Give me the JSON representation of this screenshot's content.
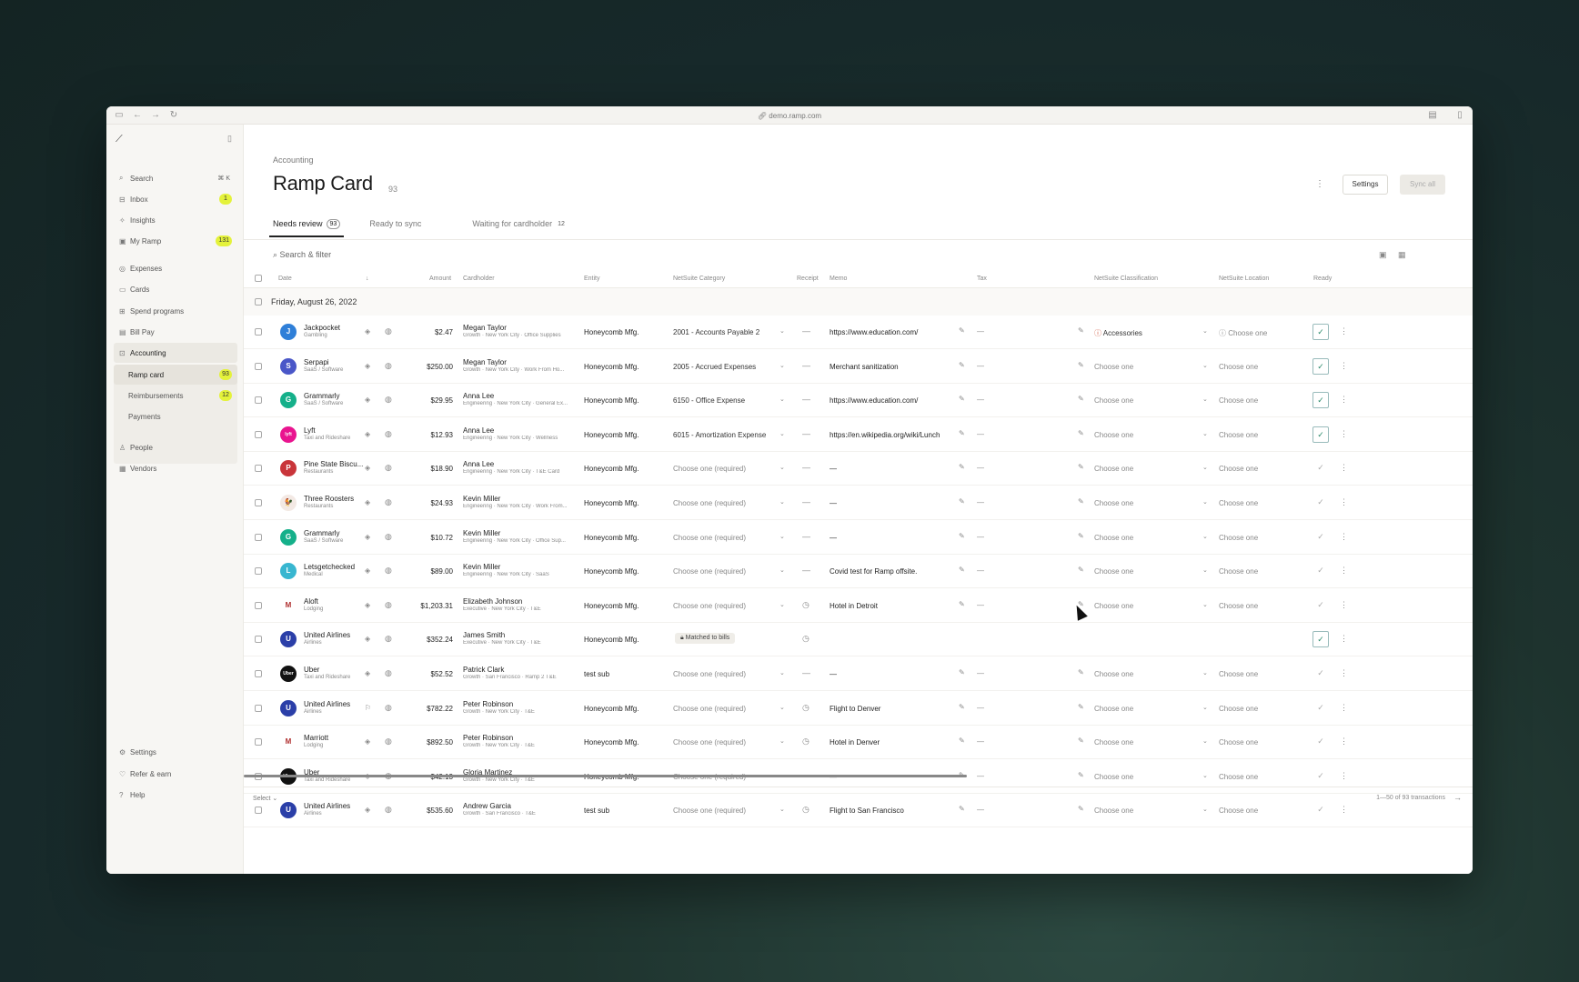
{
  "browser": {
    "url": "demo.ramp.com"
  },
  "sidebar": {
    "search": {
      "label": "Search",
      "shortcut": "⌘ K"
    },
    "items": [
      {
        "label": "Inbox",
        "badge": "1"
      },
      {
        "label": "Insights",
        "badge": ""
      },
      {
        "label": "My Ramp",
        "badge": "131"
      },
      {
        "label": "Expenses",
        "badge": ""
      },
      {
        "label": "Cards",
        "badge": ""
      },
      {
        "label": "Spend programs",
        "badge": ""
      },
      {
        "label": "Bill Pay",
        "badge": ""
      },
      {
        "label": "Accounting",
        "badge": ""
      }
    ],
    "sub_items": [
      {
        "label": "Ramp card",
        "badge": "93"
      },
      {
        "label": "Reimbursements",
        "badge": "12"
      },
      {
        "label": "Payments",
        "badge": ""
      }
    ],
    "bottom_items": [
      {
        "label": "People"
      },
      {
        "label": "Vendors"
      }
    ],
    "footer_items": [
      {
        "label": "Settings"
      },
      {
        "label": "Refer & earn"
      },
      {
        "label": "Help"
      }
    ]
  },
  "header": {
    "breadcrumb": "Accounting",
    "title": "Ramp Card",
    "count": "93",
    "settings_label": "Settings",
    "sync_label": "Sync all"
  },
  "tabs": [
    {
      "label": "Needs review",
      "count": "93"
    },
    {
      "label": "Ready to sync",
      "count": ""
    },
    {
      "label": "Waiting for cardholder",
      "count": "12"
    }
  ],
  "search_placeholder": "Search & filter",
  "columns": {
    "date": "Date",
    "amount": "Amount",
    "cardholder": "Cardholder",
    "entity": "Entity",
    "category": "NetSuite Category",
    "receipt": "Receipt",
    "memo": "Memo",
    "tax": "Tax",
    "classification": "NetSuite Classification",
    "location": "NetSuite Location",
    "ready": "Ready"
  },
  "group_label": "Friday, August 26, 2022",
  "rows": [
    {
      "merchant": "Jackpocket",
      "mcat": "Gambling",
      "amount": "$2.47",
      "cardholder": "Megan Taylor",
      "chsub": "Growth · New York City · Office Supplies",
      "entity": "Honeycomb Mfg.",
      "category": "2001 - Accounts Payable 2",
      "receipt": "—",
      "memo": "https://www.education.com/",
      "tax": "—",
      "classification": "Accessories",
      "location": "Choose one",
      "ready": true,
      "logo_color": "#2f7fd8",
      "logo_glyph": "J"
    },
    {
      "merchant": "Serpapi",
      "mcat": "SaaS / Software",
      "amount": "$250.00",
      "cardholder": "Megan Taylor",
      "chsub": "Growth · New York City · Work From Ho...",
      "entity": "Honeycomb Mfg.",
      "category": "2005 - Accrued Expenses",
      "receipt": "—",
      "memo": "Merchant sanitization",
      "tax": "—",
      "classification": "Choose one",
      "location": "Choose one",
      "ready": true,
      "logo_color": "#4a57c8",
      "logo_glyph": "S"
    },
    {
      "merchant": "Grammarly",
      "mcat": "SaaS / Software",
      "amount": "$29.95",
      "cardholder": "Anna Lee",
      "chsub": "Engineering · New York City · General Ex...",
      "entity": "Honeycomb Mfg.",
      "category": "6150 - Office Expense",
      "receipt": "—",
      "memo": "https://www.education.com/",
      "tax": "—",
      "classification": "Choose one",
      "location": "Choose one",
      "ready": true,
      "logo_color": "#15b08a",
      "logo_glyph": "G"
    },
    {
      "merchant": "Lyft",
      "mcat": "Taxi and Rideshare",
      "amount": "$12.93",
      "cardholder": "Anna Lee",
      "chsub": "Engineering · New York City · Wellness",
      "entity": "Honeycomb Mfg.",
      "category": "6015 - Amortization Expense",
      "receipt": "—",
      "memo": "https://en.wikipedia.org/wiki/Lunch",
      "tax": "—",
      "classification": "Choose one",
      "location": "Choose one",
      "ready": true,
      "logo_color": "#e9148f",
      "logo_glyph": "lyft"
    },
    {
      "merchant": "Pine State Biscu...",
      "mcat": "Restaurants",
      "amount": "$18.90",
      "cardholder": "Anna Lee",
      "chsub": "Engineering · New York City · T&E Card",
      "entity": "Honeycomb Mfg.",
      "category": "Choose one (required)",
      "receipt": "—",
      "memo": "—",
      "tax": "—",
      "classification": "Choose one",
      "location": "Choose one",
      "ready": false,
      "logo_color": "#c9353a",
      "logo_glyph": "P"
    },
    {
      "merchant": "Three Roosters",
      "mcat": "Restaurants",
      "amount": "$24.93",
      "cardholder": "Kevin Miller",
      "chsub": "Engineering · New York City · Work From...",
      "entity": "Honeycomb Mfg.",
      "category": "Choose one (required)",
      "receipt": "—",
      "memo": "—",
      "tax": "—",
      "classification": "Choose one",
      "location": "Choose one",
      "ready": false,
      "logo_color": "#f3e9e4",
      "logo_glyph": "🐓"
    },
    {
      "merchant": "Grammarly",
      "mcat": "SaaS / Software",
      "amount": "$10.72",
      "cardholder": "Kevin Miller",
      "chsub": "Engineering · New York City · Office Sup...",
      "entity": "Honeycomb Mfg.",
      "category": "Choose one (required)",
      "receipt": "—",
      "memo": "—",
      "tax": "—",
      "classification": "Choose one",
      "location": "Choose one",
      "ready": false,
      "logo_color": "#15b08a",
      "logo_glyph": "G"
    },
    {
      "merchant": "Letsgetchecked",
      "mcat": "Medical",
      "amount": "$89.00",
      "cardholder": "Kevin Miller",
      "chsub": "Engineering · New York City · SaaS",
      "entity": "Honeycomb Mfg.",
      "category": "Choose one (required)",
      "receipt": "—",
      "memo": "Covid test for Ramp offsite.",
      "tax": "—",
      "classification": "Choose one",
      "location": "Choose one",
      "ready": false,
      "logo_color": "#38b6d0",
      "logo_glyph": "L"
    },
    {
      "merchant": "Aloft",
      "mcat": "Lodging",
      "amount": "$1,203.31",
      "cardholder": "Elizabeth Johnson",
      "chsub": "Executive · New York City · T&E",
      "entity": "Honeycomb Mfg.",
      "category": "Choose one (required)",
      "receipt": "◷",
      "memo": "Hotel in Detroit",
      "tax": "—",
      "classification": "Choose one",
      "location": "Choose one",
      "ready": false,
      "logo_color": "#ffffff",
      "logo_glyph": "Marriott"
    },
    {
      "merchant": "United Airlines",
      "mcat": "Airlines",
      "amount": "$352.24",
      "cardholder": "James Smith",
      "chsub": "Executive · New York City · T&E",
      "entity": "Honeycomb Mfg.",
      "category": "Matched to bills",
      "receipt": "◷",
      "memo": "",
      "tax": "",
      "classification": "",
      "location": "",
      "ready": true,
      "logo_color": "#2b3fa8",
      "logo_glyph": "U"
    },
    {
      "merchant": "Uber",
      "mcat": "Taxi and Rideshare",
      "amount": "$52.52",
      "cardholder": "Patrick Clark",
      "chsub": "Growth · San Francisco · Ramp 2 T&E",
      "entity": "test sub",
      "category": "Choose one (required)",
      "receipt": "—",
      "memo": "—",
      "tax": "—",
      "classification": "Choose one",
      "location": "Choose one",
      "ready": false,
      "logo_color": "#111111",
      "logo_glyph": "Uber"
    },
    {
      "merchant": "United Airlines",
      "mcat": "Airlines",
      "amount": "$782.22",
      "cardholder": "Peter Robinson",
      "chsub": "Growth · New York City · T&E",
      "entity": "Honeycomb Mfg.",
      "category": "Choose one (required)",
      "receipt": "◷",
      "memo": "Flight to Denver",
      "tax": "—",
      "classification": "Choose one",
      "location": "Choose one",
      "ready": false,
      "logo_color": "#2b3fa8",
      "logo_glyph": "U"
    },
    {
      "merchant": "Marriott",
      "mcat": "Lodging",
      "amount": "$892.50",
      "cardholder": "Peter Robinson",
      "chsub": "Growth · New York City · T&E",
      "entity": "Honeycomb Mfg.",
      "category": "Choose one (required)",
      "receipt": "◷",
      "memo": "Hotel in Denver",
      "tax": "—",
      "classification": "Choose one",
      "location": "Choose one",
      "ready": false,
      "logo_color": "#ffffff",
      "logo_glyph": "Marriott"
    },
    {
      "merchant": "Uber",
      "mcat": "Taxi and Rideshare",
      "amount": "$42.13",
      "cardholder": "Gloria Martinez",
      "chsub": "Growth · New York City · T&E",
      "entity": "Honeycomb Mfg.",
      "category": "Choose one (required)",
      "receipt": "—",
      "memo": "—",
      "tax": "—",
      "classification": "Choose one",
      "location": "Choose one",
      "ready": false,
      "logo_color": "#111111",
      "logo_glyph": "Uber"
    },
    {
      "merchant": "United Airlines",
      "mcat": "Airlines",
      "amount": "$535.60",
      "cardholder": "Andrew Garcia",
      "chsub": "Growth · San Francisco · T&E",
      "entity": "test sub",
      "category": "Choose one (required)",
      "receipt": "◷",
      "memo": "Flight to San Francisco",
      "tax": "—",
      "classification": "Choose one",
      "location": "Choose one",
      "ready": false,
      "logo_color": "#2b3fa8",
      "logo_glyph": "U"
    }
  ],
  "footer": {
    "select_label": "Select",
    "pagination": "1—50 of 93 transactions"
  }
}
